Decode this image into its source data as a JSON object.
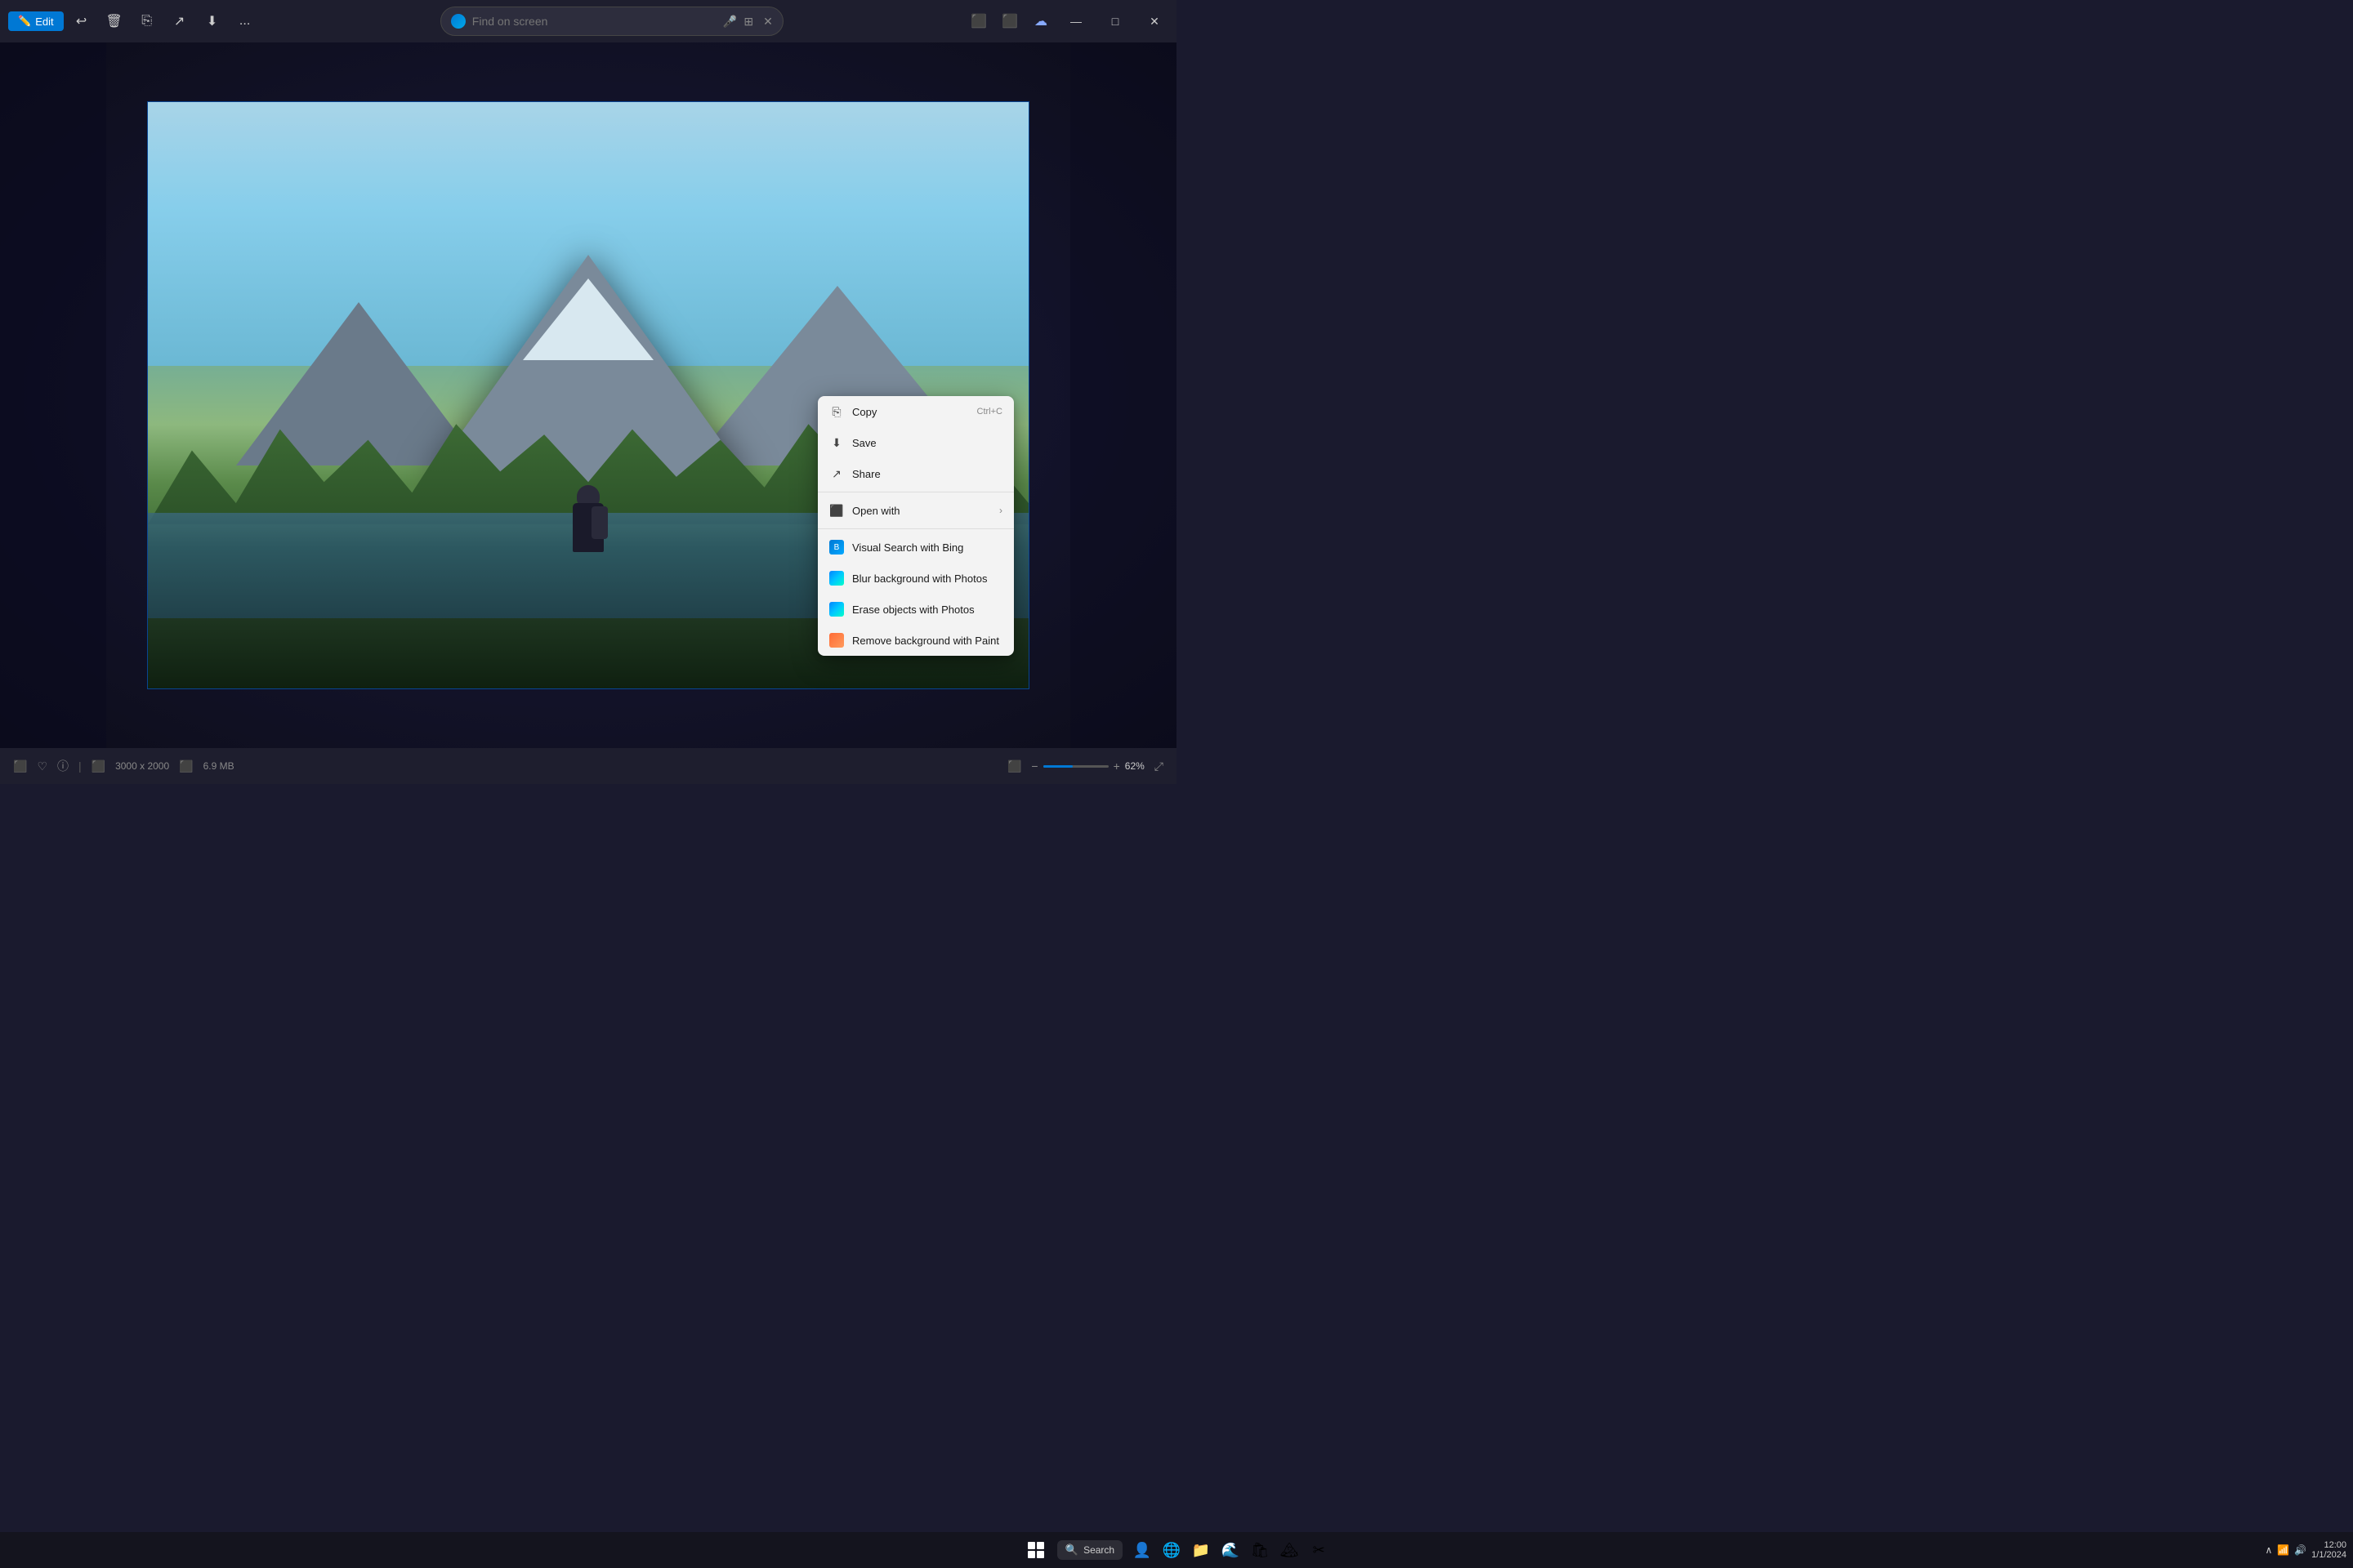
{
  "titlebar": {
    "edit_label": "Edit",
    "search_placeholder": "Find on screen",
    "more_label": "..."
  },
  "window_controls": {
    "minimize": "—",
    "maximize": "□",
    "close": "✕"
  },
  "context_menu": {
    "items": [
      {
        "id": "copy",
        "label": "Copy",
        "shortcut": "Ctrl+C",
        "icon": "copy"
      },
      {
        "id": "save",
        "label": "Save",
        "shortcut": "",
        "icon": "save"
      },
      {
        "id": "share",
        "label": "Share",
        "shortcut": "",
        "icon": "share"
      },
      {
        "id": "open-with",
        "label": "Open with",
        "shortcut": "",
        "icon": "open",
        "submenu": true
      },
      {
        "id": "visual-search",
        "label": "Visual Search with Bing",
        "shortcut": "",
        "icon": "bing"
      },
      {
        "id": "blur-bg",
        "label": "Blur background with Photos",
        "shortcut": "",
        "icon": "photos"
      },
      {
        "id": "erase-objects",
        "label": "Erase objects with Photos",
        "shortcut": "",
        "icon": "photos"
      },
      {
        "id": "remove-bg",
        "label": "Remove background with Paint",
        "shortcut": "",
        "icon": "paint"
      }
    ]
  },
  "statusbar": {
    "dimensions": "3000 x 2000",
    "filesize": "6.9 MB",
    "zoom": "62%"
  },
  "taskbar": {
    "search_label": "Search",
    "search_placeholder": "Search"
  }
}
